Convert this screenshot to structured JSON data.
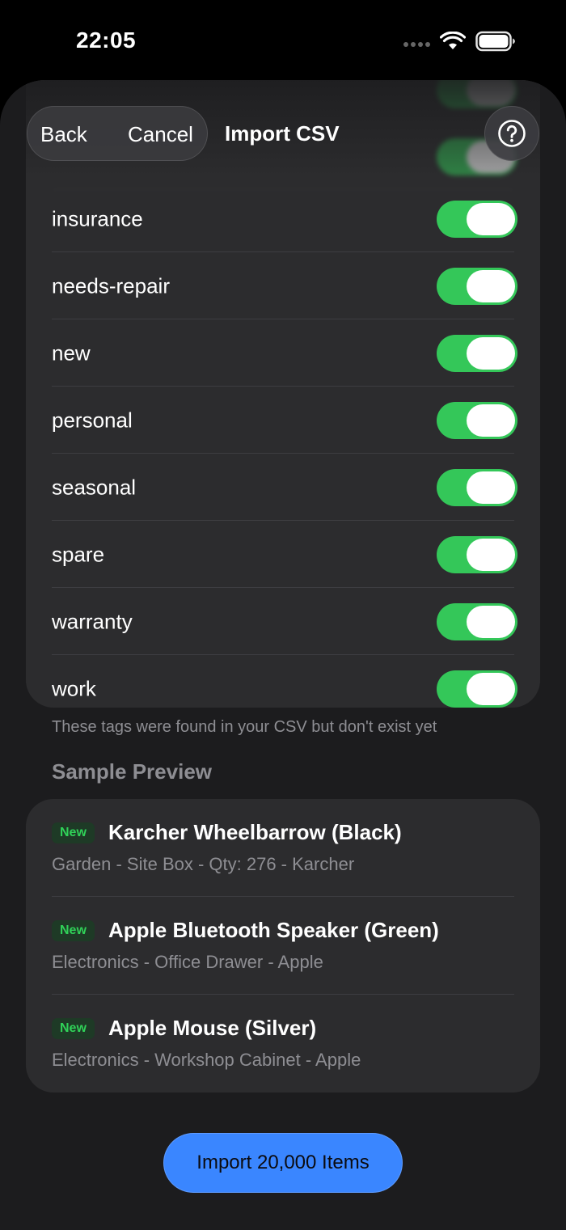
{
  "status_bar": {
    "time": "22:05",
    "wifi_icon": "wifi-icon",
    "battery_icon": "battery-icon"
  },
  "nav": {
    "back_label": "Back",
    "cancel_label": "Cancel",
    "title": "Import CSV",
    "help_icon": "question-circle-icon"
  },
  "tags": {
    "items": [
      {
        "label": "",
        "on": true
      },
      {
        "label": "",
        "on": true
      },
      {
        "label": "insurance",
        "on": true
      },
      {
        "label": "needs-repair",
        "on": true
      },
      {
        "label": "new",
        "on": true
      },
      {
        "label": "personal",
        "on": true
      },
      {
        "label": "seasonal",
        "on": true
      },
      {
        "label": "spare",
        "on": true
      },
      {
        "label": "warranty",
        "on": true
      },
      {
        "label": "work",
        "on": true
      }
    ],
    "footnote": "These tags were found in your CSV but don't exist yet"
  },
  "preview": {
    "header": "Sample Preview",
    "items": [
      {
        "badge": "New",
        "title": "Karcher Wheelbarrow (Black)",
        "subtitle": "Garden - Site Box - Qty: 276 - Karcher"
      },
      {
        "badge": "New",
        "title": "Apple Bluetooth Speaker (Green)",
        "subtitle": "Electronics - Office Drawer - Apple"
      },
      {
        "badge": "New",
        "title": "Apple Mouse (Silver)",
        "subtitle": "Electronics - Workshop Cabinet - Apple"
      }
    ]
  },
  "import_button": {
    "label": "Import 20,000 Items"
  },
  "colors": {
    "toggle_on": "#34c759",
    "accent": "#3a86ff",
    "badge_text": "#30d158"
  }
}
